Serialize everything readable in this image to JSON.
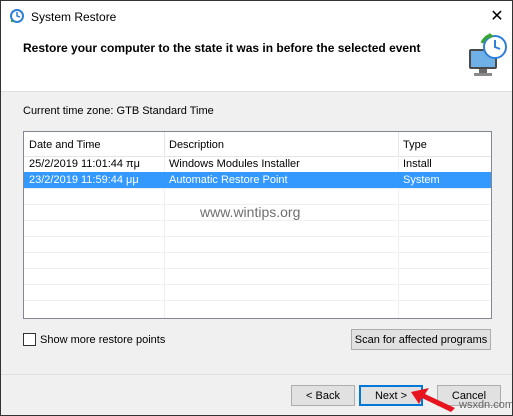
{
  "window": {
    "title": "System Restore",
    "close_glyph": "✕",
    "heading": "Restore your computer to the state it was in before the selected event"
  },
  "timezone_label": "Current time zone: GTB Standard Time",
  "table": {
    "columns": [
      "Date and Time",
      "Description",
      "Type"
    ],
    "rows": [
      {
        "date": "25/2/2019 11:01:44 πμ",
        "description": "Windows Modules Installer",
        "type": "Install",
        "selected": false
      },
      {
        "date": "23/2/2019 11:59:44 μμ",
        "description": "Automatic Restore Point",
        "type": "System",
        "selected": true
      }
    ],
    "sort_glyph": "⌄"
  },
  "watermark": "www.wintips.org",
  "show_more_label": "Show more restore points",
  "scan_button": "Scan for affected programs",
  "buttons": {
    "back": "< Back",
    "next": "Next >",
    "cancel": "Cancel"
  },
  "credit": "wsxdn.com",
  "icons": {
    "app": "system-restore-icon",
    "header": "restore-monitor-icon",
    "pointer": "red-arrow-icon"
  },
  "colors": {
    "selection": "#3399ff",
    "accent": "#0078d7",
    "arrow": "#e8141d"
  }
}
